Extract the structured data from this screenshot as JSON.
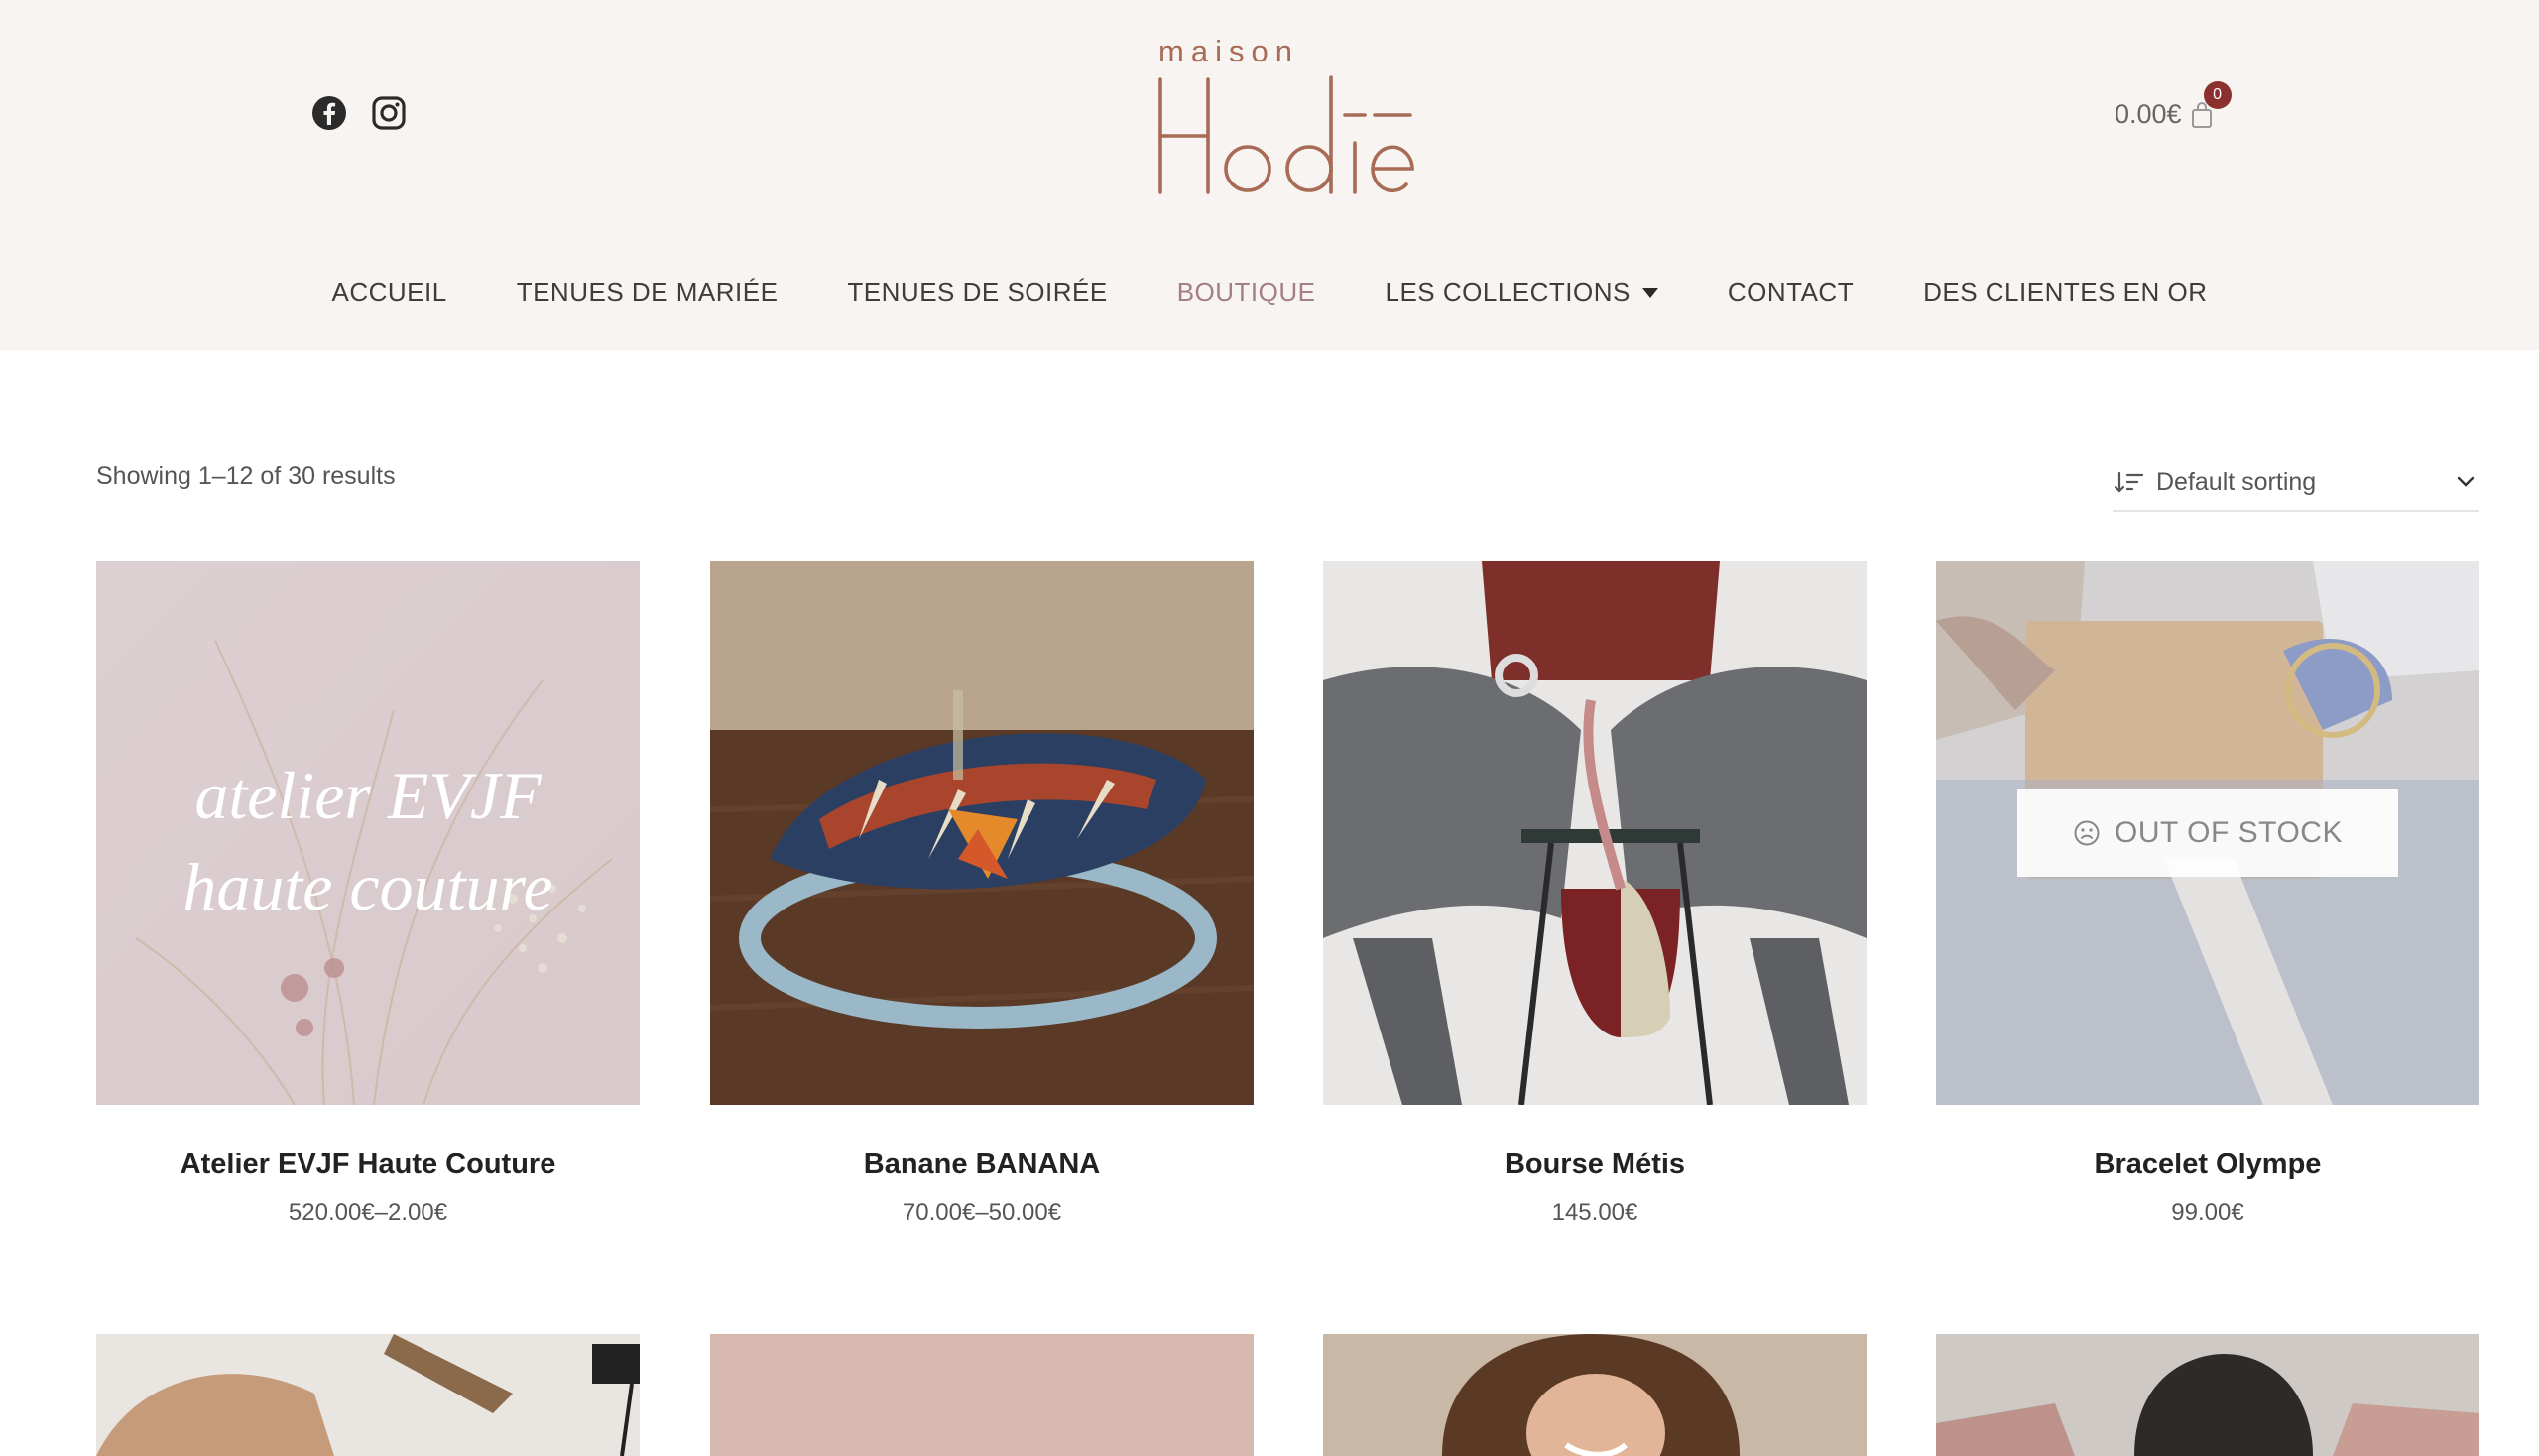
{
  "colors": {
    "header_bg": "#f8f4f1",
    "accent": "#a47e86",
    "badge": "#8b2f2f",
    "logo": "#a86b55"
  },
  "header": {
    "logo_small": "maison",
    "logo_main": "Hodie",
    "cart_total": "0.00€",
    "cart_count": "0",
    "socials": [
      "facebook-icon",
      "instagram-icon"
    ]
  },
  "nav": {
    "items": [
      {
        "label": "ACCUEIL"
      },
      {
        "label": "TENUES DE MARIÉE"
      },
      {
        "label": "TENUES DE SOIRÉE"
      },
      {
        "label": "BOUTIQUE",
        "active": true
      },
      {
        "label": "LES COLLECTIONS",
        "dropdown": true
      },
      {
        "label": "CONTACT"
      },
      {
        "label": "DES CLIENTES EN OR"
      }
    ]
  },
  "toolbar": {
    "results": "Showing 1–12 of 30 results",
    "sorting": "Default sorting"
  },
  "products": [
    {
      "name": "Atelier EVJF Haute Couture",
      "price": "520.00€–2.00€",
      "image_text_1": "atelier EVJF",
      "image_text_2": "haute couture"
    },
    {
      "name": "Banane BANANA",
      "price": "70.00€–50.00€"
    },
    {
      "name": "Bourse Métis",
      "price": "145.00€"
    },
    {
      "name": "Bracelet Olympe",
      "price": "99.00€",
      "badge": "OUT OF STOCK"
    }
  ]
}
